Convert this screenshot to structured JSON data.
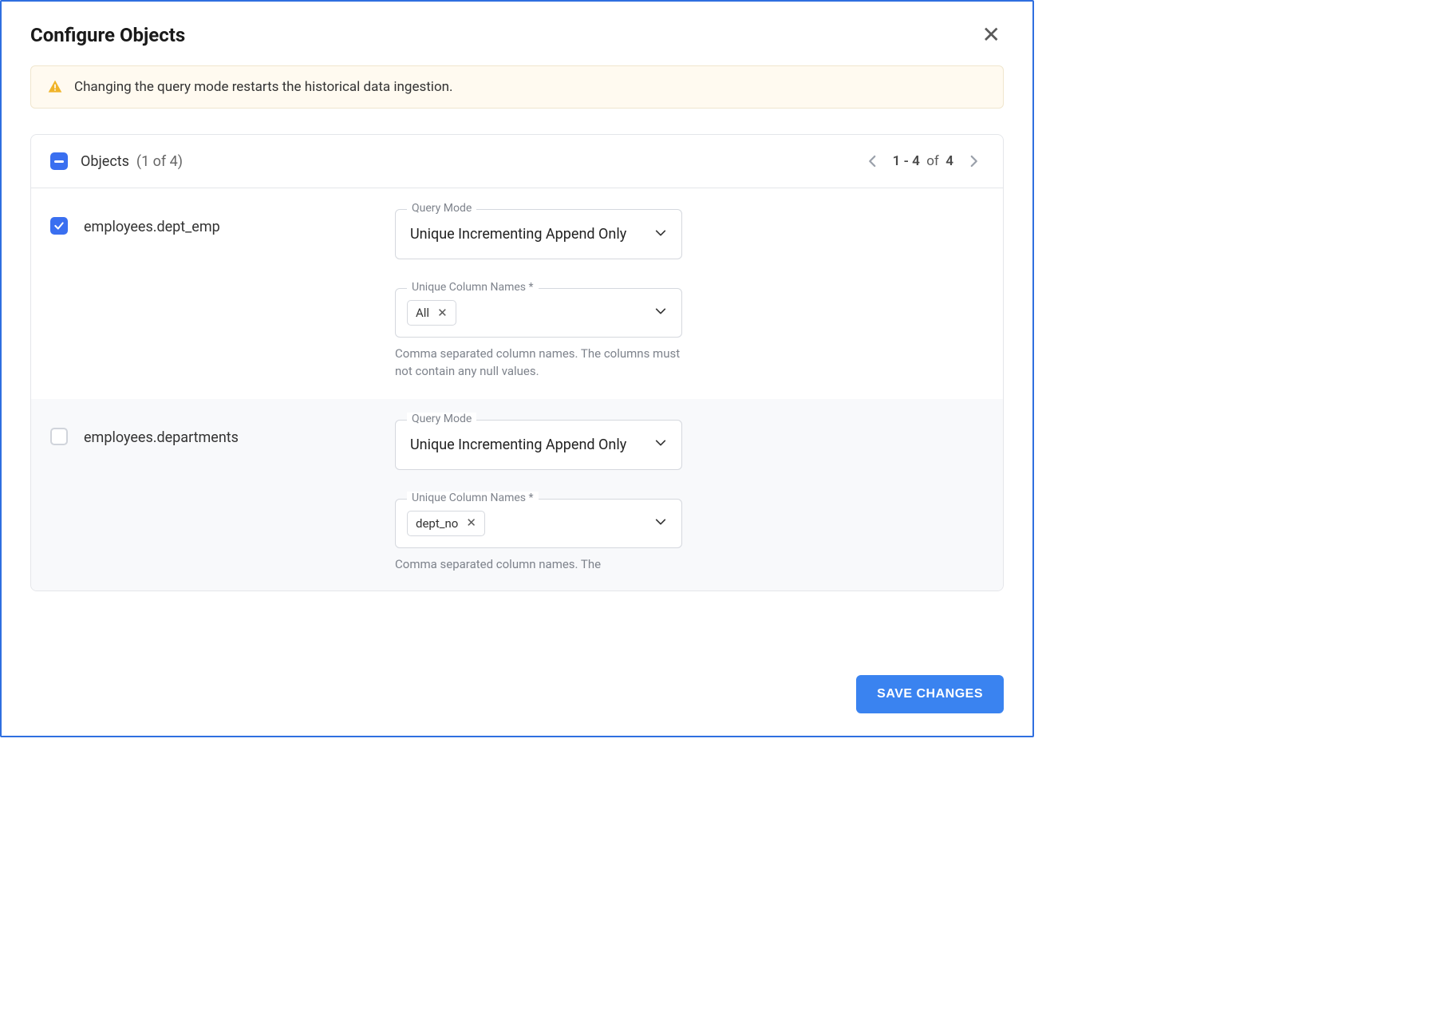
{
  "title": "Configure Objects",
  "warning": "Changing the query mode restarts the historical data ingestion.",
  "objects_header": {
    "label": "Objects",
    "count_open": "(",
    "count": "1 of 4",
    "count_close": ")"
  },
  "pagination": {
    "range_start": "1",
    "range_sep": "-",
    "range_end": "4",
    "of_label": "of",
    "total": "4"
  },
  "rows": [
    {
      "name": "employees.dept_emp",
      "checked": true,
      "query_mode_label": "Query Mode",
      "query_mode_value": "Unique Incrementing Append Only",
      "unique_cols_label": "Unique Column Names *",
      "chips": [
        "All"
      ],
      "helper": "Comma separated column names. The columns must not contain any null values."
    },
    {
      "name": "employees.departments",
      "checked": false,
      "query_mode_label": "Query Mode",
      "query_mode_value": "Unique Incrementing Append Only",
      "unique_cols_label": "Unique Column Names *",
      "chips": [
        "dept_no"
      ],
      "helper": "Comma separated column names. The"
    }
  ],
  "footer": {
    "save_label": "SAVE CHANGES"
  }
}
